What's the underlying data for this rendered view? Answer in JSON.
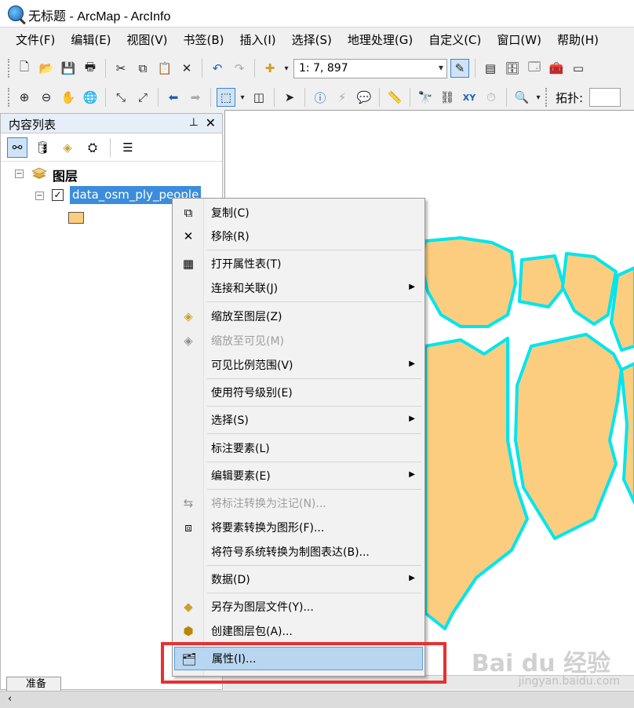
{
  "window": {
    "title": "无标题 - ArcMap - ArcInfo"
  },
  "menu": [
    "文件(F)",
    "编辑(E)",
    "视图(V)",
    "书签(B)",
    "插入(I)",
    "选择(S)",
    "地理处理(G)",
    "自定义(C)",
    "窗口(W)",
    "帮助(H)"
  ],
  "toolbar": {
    "scale": "1: 7, 897",
    "topology_label": "拓扑:"
  },
  "toc": {
    "title": "内容列表",
    "pin": "⊥",
    "close": "✕",
    "layers_label": "图层",
    "layer_name": "data_osm_ply_people",
    "checked": "✓"
  },
  "context_menu": {
    "items": [
      {
        "label": "复制(C)",
        "icon": "copy-icon",
        "enabled": true,
        "submenu": false
      },
      {
        "label": "移除(R)",
        "icon": "remove-x-icon",
        "enabled": true,
        "submenu": false
      },
      {
        "label": "打开属性表(T)",
        "icon": "table-icon",
        "enabled": true,
        "submenu": false
      },
      {
        "label": "连接和关联(J)",
        "icon": "",
        "enabled": true,
        "submenu": true
      },
      {
        "label": "缩放至图层(Z)",
        "icon": "zoom-layer-icon",
        "enabled": true,
        "submenu": false
      },
      {
        "label": "缩放至可见(M)",
        "icon": "zoom-visible-icon",
        "enabled": false,
        "submenu": false
      },
      {
        "label": "可见比例范围(V)",
        "icon": "",
        "enabled": true,
        "submenu": true
      },
      {
        "label": "使用符号级别(E)",
        "icon": "",
        "enabled": true,
        "submenu": false
      },
      {
        "label": "选择(S)",
        "icon": "",
        "enabled": true,
        "submenu": true
      },
      {
        "label": "标注要素(L)",
        "icon": "",
        "enabled": true,
        "submenu": false
      },
      {
        "label": "编辑要素(E)",
        "icon": "",
        "enabled": true,
        "submenu": true
      },
      {
        "label": "将标注转换为注记(N)...",
        "icon": "convert-labels-icon",
        "enabled": false,
        "submenu": false
      },
      {
        "label": "将要素转换为图形(F)...",
        "icon": "convert-graphics-icon",
        "enabled": true,
        "submenu": false
      },
      {
        "label": "将符号系统转换为制图表达(B)...",
        "icon": "",
        "enabled": true,
        "submenu": false
      },
      {
        "label": "数据(D)",
        "icon": "",
        "enabled": true,
        "submenu": true
      },
      {
        "label": "另存为图层文件(Y)...",
        "icon": "layer-file-icon",
        "enabled": true,
        "submenu": false
      },
      {
        "label": "创建图层包(A)...",
        "icon": "layer-package-icon",
        "enabled": true,
        "submenu": false
      },
      {
        "label": "属性(I)...",
        "icon": "properties-icon",
        "enabled": true,
        "submenu": false
      }
    ]
  },
  "bottom_tab": "准备",
  "watermark": {
    "main": "Bai du 经验",
    "sub": "jingyan.baidu.com"
  },
  "colors": {
    "polygon_fill": "#fccd7e",
    "polygon_outline": "#00e5ee",
    "highlight": "#b9d6f0",
    "annotation_red": "#e83030"
  }
}
